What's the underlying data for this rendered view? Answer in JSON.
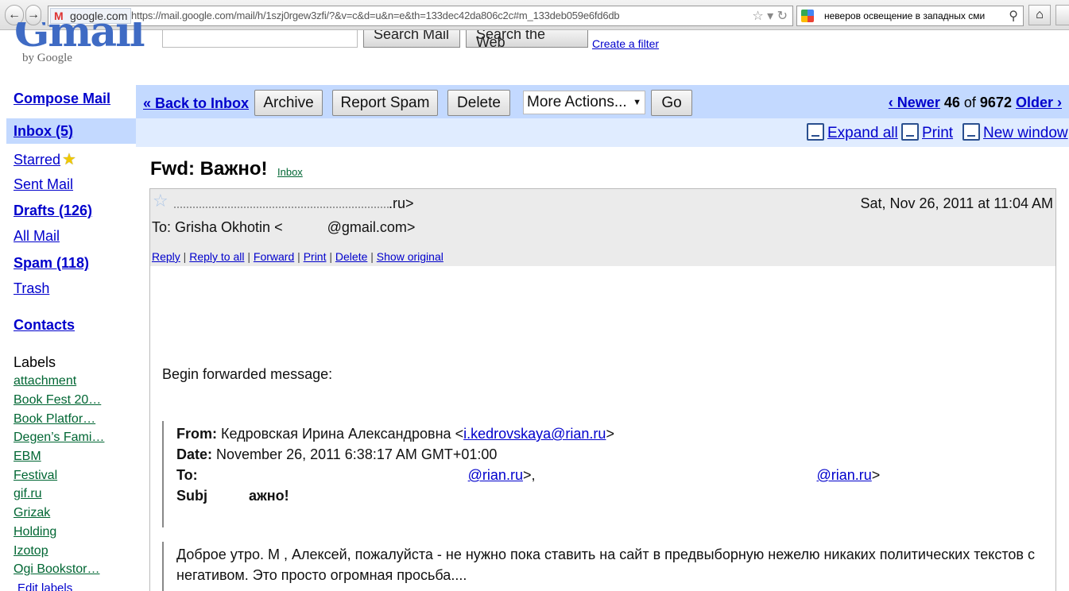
{
  "browser": {
    "back_icon": "back-arrow-icon",
    "forward_icon": "forward-arrow-icon",
    "site_identity": "google.com",
    "url": "https://mail.google.com/mail/h/1szj0rgew3zfi/?&v=c&d=u&n=e&th=133dec42da806c2c#m_133deb059e6fd6db",
    "search_query": "неверов освещение в западных сми"
  },
  "gmail": {
    "logo_by": "by Google",
    "logo_word": "Gmail",
    "search_mail": "Search Mail",
    "search_web": "Search the Web",
    "create_filter": "Create a filter"
  },
  "nav": {
    "compose": "Compose Mail",
    "inbox": "Inbox (5)",
    "starred": "Starred",
    "sent": "Sent Mail",
    "drafts": "Drafts (126)",
    "all": "All Mail",
    "spam": "Spam (118)",
    "trash": "Trash",
    "contacts": "Contacts",
    "labels_title": "Labels",
    "labels": [
      "attachment",
      "Book Fest 20…",
      "Book Platfor…",
      "Degen’s Fami…",
      "EBM",
      "Festival",
      "gif.ru",
      "Grizak",
      "Holding",
      "Izotop",
      "Ogi Bookstor…"
    ],
    "edit_labels": "Edit labels"
  },
  "toolbar": {
    "back": "« Back to Inbox",
    "archive": "Archive",
    "report_spam": "Report Spam",
    "delete": "Delete",
    "more_actions": "More Actions...",
    "go": "Go",
    "newer": "‹ Newer",
    "pos": "46",
    "of": "of",
    "total": "9672",
    "older": "Older ›",
    "expand_all": "Expand all",
    "print": "Print",
    "new_window": "New window"
  },
  "message": {
    "subject": "Fwd: Важно!",
    "label": "Inbox",
    "from_suffix": ".ru>",
    "date": "Sat, Nov 26, 2011 at 11:04 AM",
    "to_prefix": "To: Grisha Okhotin <",
    "to_suffix": "@gmail.com>",
    "actions": [
      "Reply",
      "Reply to all",
      "Forward",
      "Print",
      "Delete",
      "Show original"
    ],
    "body_lines": [
      "Begin forwarded message:"
    ],
    "fwd_from_label": "From:",
    "fwd_from_name": "Кедровская Ирина Александровна <",
    "fwd_from_email": "i.kedrovskaya@rian.ru",
    "fwd_from_end": ">",
    "fwd_date_label": "Date:",
    "fwd_date": "November 26, 2011 6:38:17 AM GMT+01:00",
    "fwd_to_label": "To:",
    "fwd_to_email1": "@rian.ru",
    "fwd_to_email2": "@rian.ru",
    "fwd_subj_label": "Subj",
    "fwd_subj_tail": "ажно!",
    "quote_line1": "Доброе утро. М        , Алексей, пожалуйста - не нужно пока ставить на сайт в предвыборную нежелю никаких политических текстов с",
    "quote_line2": "негативом. Это просто огромная просьба...."
  }
}
